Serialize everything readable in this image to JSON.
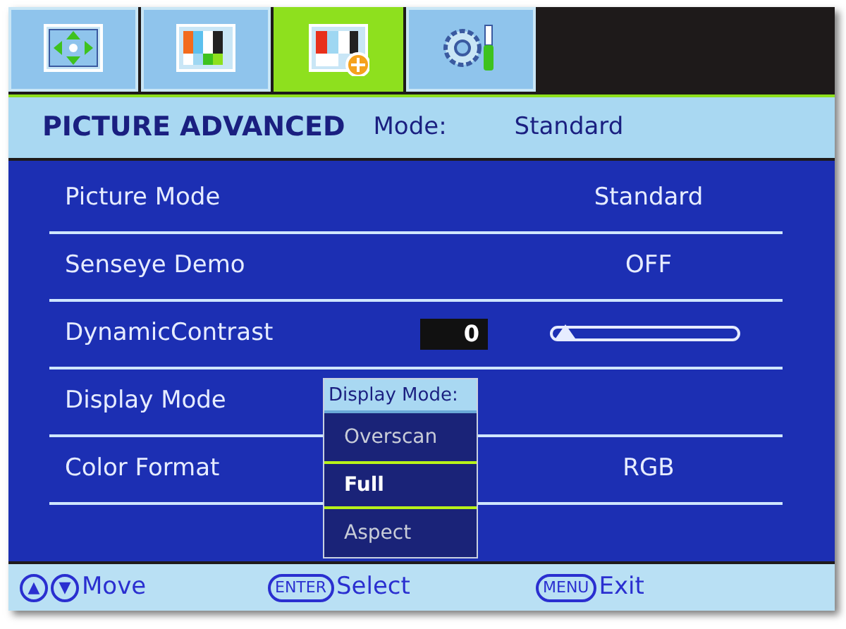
{
  "tabs": [
    {
      "kind": "arrows",
      "selected": false
    },
    {
      "kind": "bars",
      "selected": false
    },
    {
      "kind": "bars-plus",
      "selected": true
    },
    {
      "kind": "gear-tool",
      "selected": false
    }
  ],
  "header": {
    "title": "PICTURE ADVANCED",
    "mode_label": "Mode:",
    "mode_value": "Standard"
  },
  "rows": [
    {
      "kind": "value",
      "label": "Picture Mode",
      "value": "Standard"
    },
    {
      "kind": "value",
      "label": "Senseye Demo",
      "value": "OFF"
    },
    {
      "kind": "slider",
      "label": "DynamicContrast",
      "value": "0",
      "level": 0
    },
    {
      "kind": "dropdown",
      "label": "Display Mode"
    },
    {
      "kind": "value",
      "label": "Color Format",
      "value": "RGB"
    }
  ],
  "popup": {
    "title": "Display Mode:",
    "options": [
      {
        "label": "Overscan",
        "selected": false
      },
      {
        "label": "Full",
        "selected": true
      },
      {
        "label": "Aspect",
        "selected": false
      }
    ]
  },
  "footer": [
    {
      "keys": [
        "▲",
        "▼"
      ],
      "action": "Move"
    },
    {
      "keys": [
        "ENTER"
      ],
      "action": "Select"
    },
    {
      "keys": [
        "MENU"
      ],
      "action": "Exit"
    }
  ]
}
